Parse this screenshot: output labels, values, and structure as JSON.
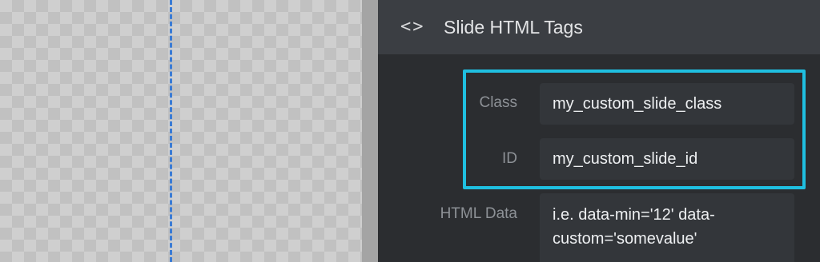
{
  "panel": {
    "header": {
      "icon": "code-brackets-icon",
      "title": "Slide HTML Tags"
    },
    "fields": {
      "class_label": "Class",
      "class_value": "my_custom_slide_class",
      "id_label": "ID",
      "id_value": "my_custom_slide_id",
      "html_data_label": "HTML Data",
      "html_data_value": "i.e. data-min='12' data-custom='somevalue'"
    }
  },
  "colors": {
    "highlight": "#1fbfe0",
    "guide_line": "#3a7bd5",
    "panel_bg": "#2b2d30",
    "header_bg": "#3b3e43"
  }
}
